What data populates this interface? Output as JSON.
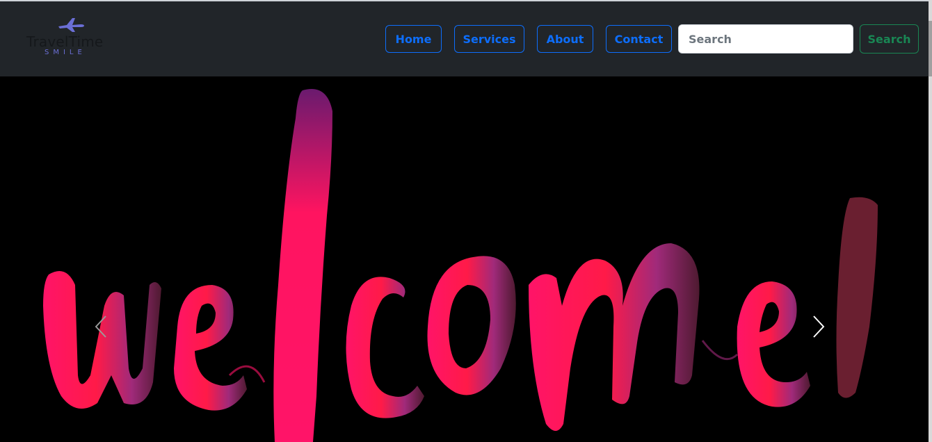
{
  "brand": {
    "title": "TravelTime",
    "subtitle": "SMILE",
    "icon": "airplane-icon",
    "colors": {
      "icon": "#6b6fd6",
      "title": "#15181b"
    }
  },
  "nav": {
    "items": [
      {
        "label": "Home"
      },
      {
        "label": "Services"
      },
      {
        "label": "About"
      },
      {
        "label": "Contact"
      }
    ],
    "accent": "#0d6efd"
  },
  "search": {
    "placeholder": "Search",
    "value": "",
    "button_label": "Search",
    "button_color": "#198754"
  },
  "carousel": {
    "slide_text": "welcome!",
    "prev_icon": "chevron-left-icon",
    "next_icon": "chevron-right-icon",
    "gradient": [
      "#ff1460",
      "#ff1a4a",
      "#8e2a8a",
      "#5a1d3a"
    ]
  },
  "theme": {
    "navbar_bg": "#212529",
    "page_bg": "#000000"
  }
}
